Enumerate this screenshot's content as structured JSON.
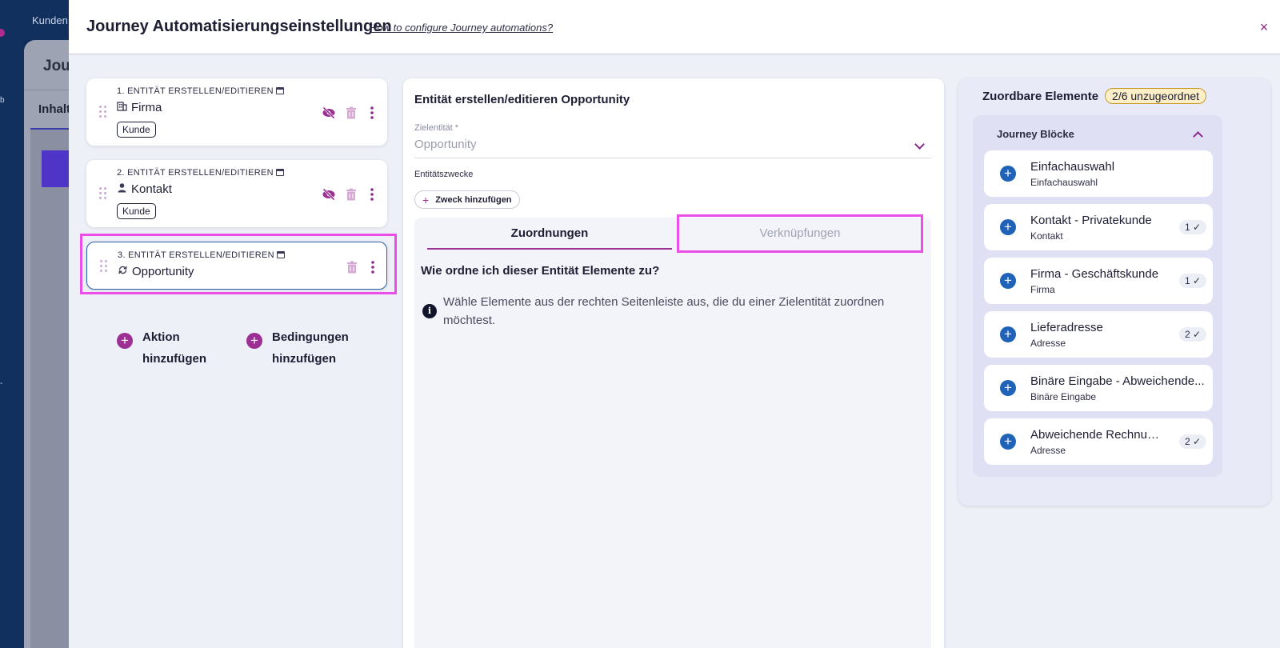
{
  "background": {
    "topnav_fragment": "Kunden",
    "page_title_fragment": "Jou",
    "tab_fragment": "Inhalt",
    "side_fragments": [
      "b",
      "-"
    ]
  },
  "modal": {
    "title": "Journey Automatisierungseinstellungen",
    "help_link": "How to configure Journey automations?",
    "close_label": "×"
  },
  "steps": [
    {
      "label": "1. ENTITÄT ERSTELLEN/EDITIEREN",
      "name": "Firma",
      "icon": "building-icon",
      "tag": "Kunde"
    },
    {
      "label": "2. ENTITÄT ERSTELLEN/EDITIEREN",
      "name": "Kontakt",
      "icon": "person-icon",
      "tag": "Kunde"
    },
    {
      "label": "3. ENTITÄT ERSTELLEN/EDITIEREN",
      "name": "Opportunity",
      "icon": "refresh-icon",
      "tag": ""
    }
  ],
  "add_actions": {
    "action_label": "Aktion hinzufügen",
    "condition_label": "Bedingungen hinzufügen"
  },
  "editor": {
    "title": "Entität erstellen/editieren Opportunity",
    "target_label": "Zielentität *",
    "target_value": "Opportunity",
    "purpose_label": "Entitätszwecke",
    "purpose_button": "Zweck hinzufügen",
    "tabs": [
      "Zuordnungen",
      "Verknüpfungen"
    ],
    "how_title": "Wie ordne ich dieser Entität Elemente zu?",
    "info_text": "Wähle Elemente aus der rechten Seitenleiste aus, die du einer Zielentität zuordnen möchtest."
  },
  "assignable": {
    "title": "Zuordbare Elemente",
    "badge": "2/6 unzugeordnet",
    "group_title": "Journey Blöcke",
    "items": [
      {
        "name": "Einfachauswahl",
        "type": "Einfachauswahl",
        "count": ""
      },
      {
        "name": "Kontakt - Privatekunde",
        "type": "Kontakt",
        "count": "1 ✓"
      },
      {
        "name": "Firma - Geschäftskunde",
        "type": "Firma",
        "count": "1 ✓"
      },
      {
        "name": "Lieferadresse",
        "type": "Adresse",
        "count": "2 ✓"
      },
      {
        "name": "Binäre Eingabe - Abweichende...",
        "type": "Binäre Eingabe",
        "count": ""
      },
      {
        "name": "Abweichende Rechnun...",
        "type": "Adresse",
        "count": "2 ✓"
      }
    ]
  },
  "colors": {
    "accent_purple": "#9b2f93",
    "highlight_pink": "#ea4ee6",
    "add_blue": "#2062b8",
    "badge_bg": "#fcefc8"
  }
}
